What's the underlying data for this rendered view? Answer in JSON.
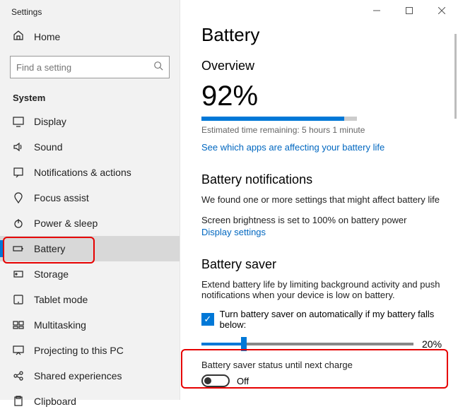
{
  "window": {
    "title": "Settings"
  },
  "sidebar": {
    "home": "Home",
    "search_placeholder": "Find a setting",
    "category": "System",
    "items": [
      {
        "label": "Display"
      },
      {
        "label": "Sound"
      },
      {
        "label": "Notifications & actions"
      },
      {
        "label": "Focus assist"
      },
      {
        "label": "Power & sleep"
      },
      {
        "label": "Battery"
      },
      {
        "label": "Storage"
      },
      {
        "label": "Tablet mode"
      },
      {
        "label": "Multitasking"
      },
      {
        "label": "Projecting to this PC"
      },
      {
        "label": "Shared experiences"
      },
      {
        "label": "Clipboard"
      }
    ]
  },
  "main": {
    "title": "Battery",
    "overview": {
      "heading": "Overview",
      "percent": "92%",
      "percent_value": 92,
      "estimate": "Estimated time remaining:  5 hours 1 minute",
      "apps_link": "See which apps are affecting your battery life"
    },
    "notifications": {
      "heading": "Battery notifications",
      "found": "We found one or more settings that might affect battery life",
      "brightness": "Screen brightness is set to 100% on battery power",
      "display_link": "Display settings"
    },
    "saver": {
      "heading": "Battery saver",
      "desc": "Extend battery life by limiting background activity and push notifications when your device is low on battery.",
      "checkbox_label": "Turn battery saver on automatically if my battery falls below:",
      "slider_value": 20,
      "slider_label": "20%",
      "toggle_label": "Battery saver status until next charge",
      "toggle_state": "Off"
    }
  }
}
